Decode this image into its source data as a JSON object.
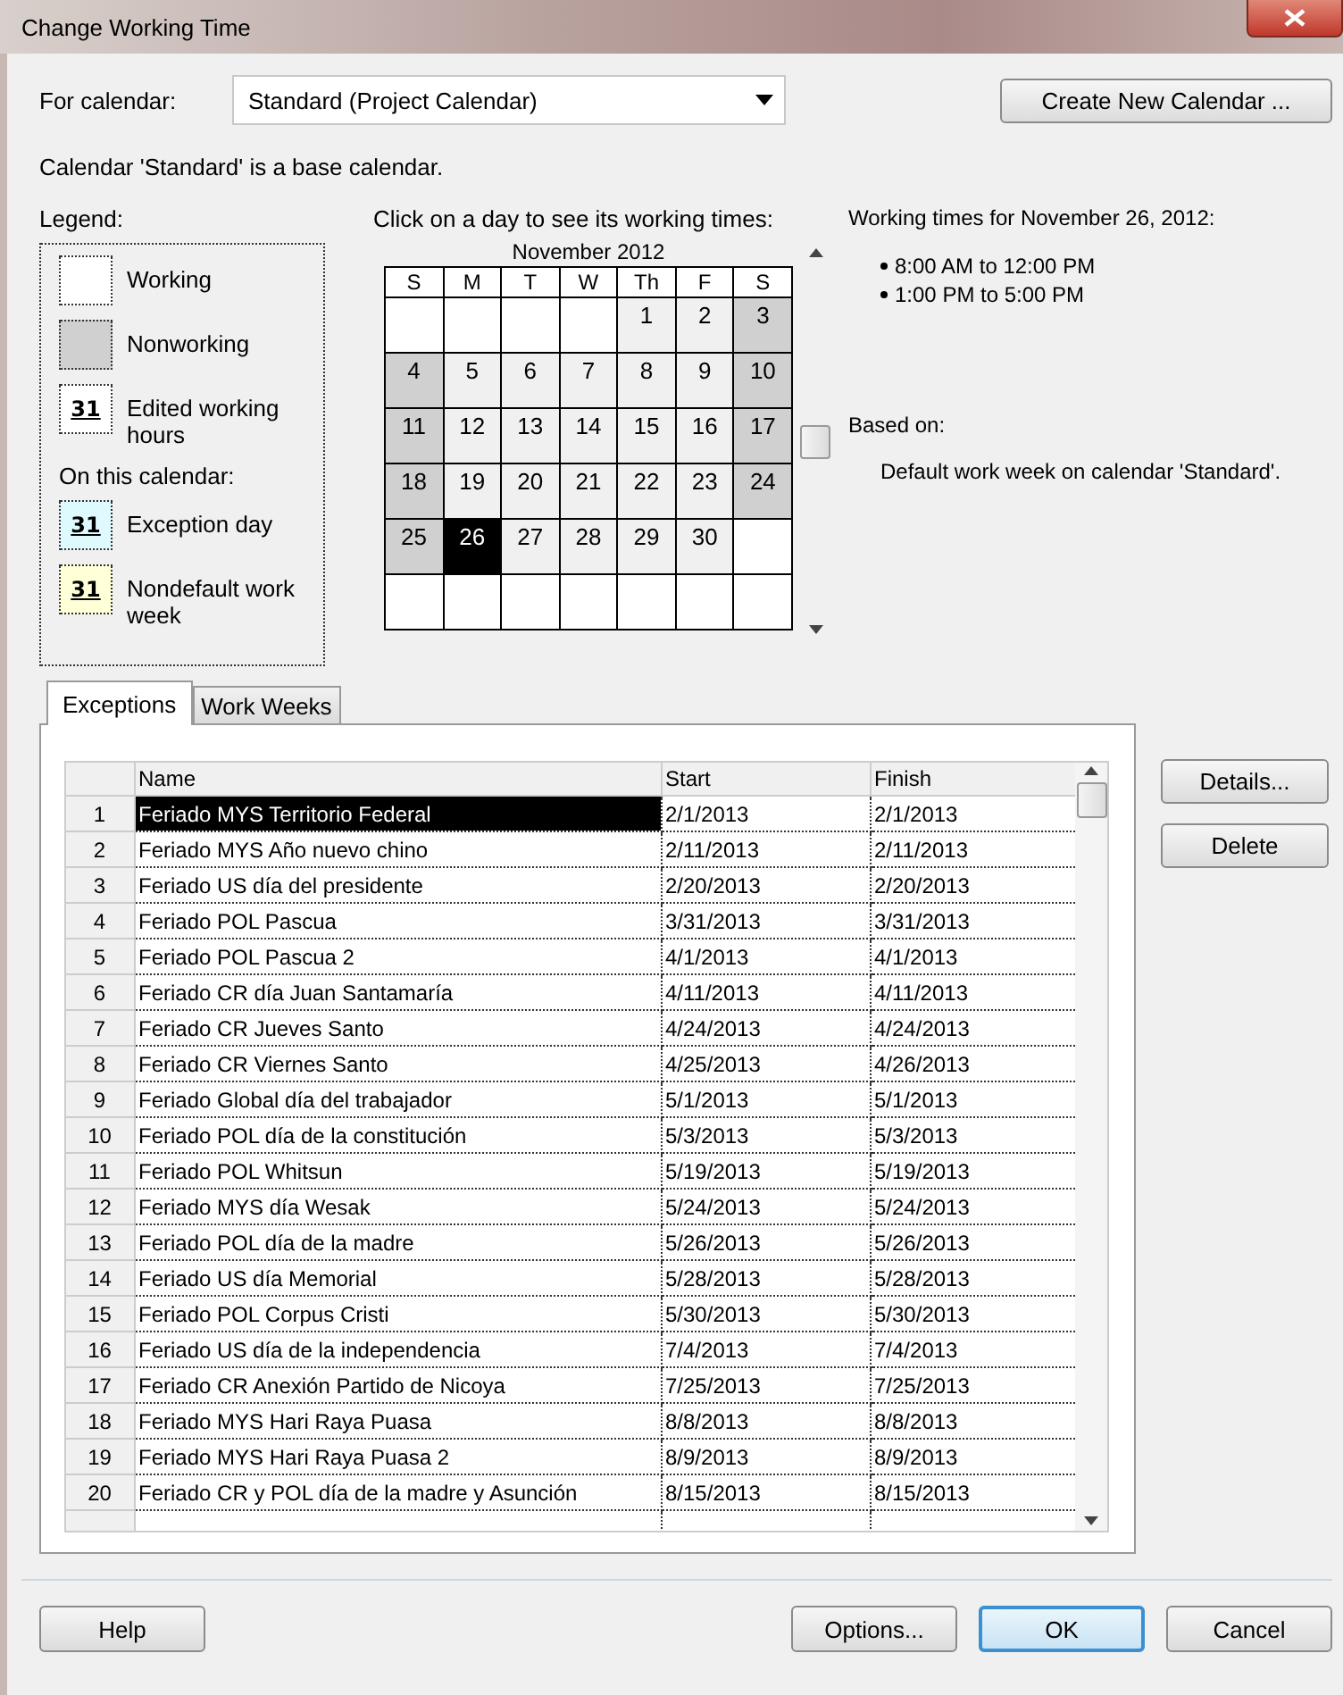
{
  "window": {
    "title": "Change Working Time"
  },
  "for_calendar": {
    "label": "For calendar:",
    "value": "Standard (Project Calendar)"
  },
  "create_button": "Create New Calendar ...",
  "calendar_note": "Calendar 'Standard' is a base calendar.",
  "legend": {
    "title": "Legend:",
    "items": [
      {
        "kind": "working",
        "label": "Working"
      },
      {
        "kind": "nonworking",
        "label": "Nonworking"
      },
      {
        "kind": "edited",
        "mark": "31",
        "label": "Edited working hours"
      }
    ],
    "subtitle": "On this calendar:",
    "calendar_items": [
      {
        "kind": "exception",
        "mark": "31",
        "label": "Exception day"
      },
      {
        "kind": "nondefault",
        "mark": "31",
        "label": "Nondefault work week"
      }
    ]
  },
  "calendar": {
    "instruction": "Click on a day to see its working times:",
    "month": "November 2012",
    "weekdays": [
      "S",
      "M",
      "T",
      "W",
      "Th",
      "F",
      "S"
    ],
    "weeks": [
      [
        {
          "kind": "empty"
        },
        {
          "kind": "empty"
        },
        {
          "kind": "empty"
        },
        {
          "kind": "empty"
        },
        {
          "kind": "day",
          "day": "1",
          "nonworking": false,
          "selected": false
        },
        {
          "kind": "day",
          "day": "2",
          "nonworking": false,
          "selected": false
        },
        {
          "kind": "day",
          "day": "3",
          "nonworking": true,
          "selected": false
        }
      ],
      [
        {
          "kind": "day",
          "day": "4",
          "nonworking": true,
          "selected": false
        },
        {
          "kind": "day",
          "day": "5",
          "nonworking": false,
          "selected": false
        },
        {
          "kind": "day",
          "day": "6",
          "nonworking": false,
          "selected": false
        },
        {
          "kind": "day",
          "day": "7",
          "nonworking": false,
          "selected": false
        },
        {
          "kind": "day",
          "day": "8",
          "nonworking": false,
          "selected": false
        },
        {
          "kind": "day",
          "day": "9",
          "nonworking": false,
          "selected": false
        },
        {
          "kind": "day",
          "day": "10",
          "nonworking": true,
          "selected": false
        }
      ],
      [
        {
          "kind": "day",
          "day": "11",
          "nonworking": true,
          "selected": false
        },
        {
          "kind": "day",
          "day": "12",
          "nonworking": false,
          "selected": false
        },
        {
          "kind": "day",
          "day": "13",
          "nonworking": false,
          "selected": false
        },
        {
          "kind": "day",
          "day": "14",
          "nonworking": false,
          "selected": false
        },
        {
          "kind": "day",
          "day": "15",
          "nonworking": false,
          "selected": false
        },
        {
          "kind": "day",
          "day": "16",
          "nonworking": false,
          "selected": false
        },
        {
          "kind": "day",
          "day": "17",
          "nonworking": true,
          "selected": false
        }
      ],
      [
        {
          "kind": "day",
          "day": "18",
          "nonworking": true,
          "selected": false
        },
        {
          "kind": "day",
          "day": "19",
          "nonworking": false,
          "selected": false
        },
        {
          "kind": "day",
          "day": "20",
          "nonworking": false,
          "selected": false
        },
        {
          "kind": "day",
          "day": "21",
          "nonworking": false,
          "selected": false
        },
        {
          "kind": "day",
          "day": "22",
          "nonworking": false,
          "selected": false
        },
        {
          "kind": "day",
          "day": "23",
          "nonworking": false,
          "selected": false
        },
        {
          "kind": "day",
          "day": "24",
          "nonworking": true,
          "selected": false
        }
      ],
      [
        {
          "kind": "day",
          "day": "25",
          "nonworking": true,
          "selected": false
        },
        {
          "kind": "day",
          "day": "26",
          "selected": true
        },
        {
          "kind": "day",
          "day": "27",
          "nonworking": false,
          "selected": false
        },
        {
          "kind": "day",
          "day": "28",
          "nonworking": false,
          "selected": false
        },
        {
          "kind": "day",
          "day": "29",
          "nonworking": false,
          "selected": false
        },
        {
          "kind": "day",
          "day": "30",
          "nonworking": false,
          "selected": false
        },
        {
          "kind": "empty"
        }
      ],
      [
        {
          "kind": "empty"
        },
        {
          "kind": "empty"
        },
        {
          "kind": "empty"
        },
        {
          "kind": "empty"
        },
        {
          "kind": "empty"
        },
        {
          "kind": "empty"
        },
        {
          "kind": "empty"
        }
      ]
    ]
  },
  "working_times": {
    "title": "Working times for November 26, 2012:",
    "times": [
      "8:00 AM to 12:00 PM",
      "1:00 PM to 5:00 PM"
    ],
    "based_on_label": "Based on:",
    "based_on": "Default work week on calendar 'Standard'."
  },
  "tabs": [
    {
      "label": "Exceptions",
      "selected": true
    },
    {
      "label": "Work Weeks",
      "selected": false
    }
  ],
  "table": {
    "columns": [
      "Name",
      "Start",
      "Finish"
    ],
    "rows": [
      {
        "num": "1",
        "name": "Feriado MYS Territorio Federal",
        "start": "2/1/2013",
        "finish": "2/1/2013",
        "selected": true
      },
      {
        "num": "2",
        "name": "Feriado MYS Año nuevo chino",
        "start": "2/11/2013",
        "finish": "2/11/2013",
        "selected": false
      },
      {
        "num": "3",
        "name": "Feriado US día del presidente",
        "start": "2/20/2013",
        "finish": "2/20/2013",
        "selected": false
      },
      {
        "num": "4",
        "name": "Feriado POL Pascua",
        "start": "3/31/2013",
        "finish": "3/31/2013",
        "selected": false
      },
      {
        "num": "5",
        "name": "Feriado POL Pascua 2",
        "start": "4/1/2013",
        "finish": "4/1/2013",
        "selected": false
      },
      {
        "num": "6",
        "name": "Feriado CR día Juan Santamaría",
        "start": "4/11/2013",
        "finish": "4/11/2013",
        "selected": false
      },
      {
        "num": "7",
        "name": "Feriado CR Jueves Santo",
        "start": "4/24/2013",
        "finish": "4/24/2013",
        "selected": false
      },
      {
        "num": "8",
        "name": "Feriado CR Viernes Santo",
        "start": "4/25/2013",
        "finish": "4/26/2013",
        "selected": false
      },
      {
        "num": "9",
        "name": "Feriado Global día del trabajador",
        "start": "5/1/2013",
        "finish": "5/1/2013",
        "selected": false
      },
      {
        "num": "10",
        "name": "Feriado POL día de la constitución",
        "start": "5/3/2013",
        "finish": "5/3/2013",
        "selected": false
      },
      {
        "num": "11",
        "name": "Feriado POL Whitsun",
        "start": "5/19/2013",
        "finish": "5/19/2013",
        "selected": false
      },
      {
        "num": "12",
        "name": "Feriado MYS día Wesak",
        "start": "5/24/2013",
        "finish": "5/24/2013",
        "selected": false
      },
      {
        "num": "13",
        "name": "Feriado POL día de la madre",
        "start": "5/26/2013",
        "finish": "5/26/2013",
        "selected": false
      },
      {
        "num": "14",
        "name": "Feriado US día Memorial",
        "start": "5/28/2013",
        "finish": "5/28/2013",
        "selected": false
      },
      {
        "num": "15",
        "name": "Feriado POL Corpus Cristi",
        "start": "5/30/2013",
        "finish": "5/30/2013",
        "selected": false
      },
      {
        "num": "16",
        "name": "Feriado US día de  la independencia",
        "start": "7/4/2013",
        "finish": "7/4/2013",
        "selected": false
      },
      {
        "num": "17",
        "name": "Feriado CR Anexión  Partido de Nicoya",
        "start": "7/25/2013",
        "finish": "7/25/2013",
        "selected": false
      },
      {
        "num": "18",
        "name": "Feriado MYS Hari Raya Puasa",
        "start": "8/8/2013",
        "finish": "8/8/2013",
        "selected": false
      },
      {
        "num": "19",
        "name": "Feriado MYS Hari Raya Puasa 2",
        "start": "8/9/2013",
        "finish": "8/9/2013",
        "selected": false
      },
      {
        "num": "20",
        "name": "Feriado CR y POL día de la madre y Asunción",
        "start": "8/15/2013",
        "finish": "8/15/2013",
        "selected": false
      }
    ]
  },
  "side_buttons": [
    "Details...",
    "Delete"
  ],
  "footer": {
    "help": "Help",
    "buttons": [
      {
        "label": "Options...",
        "default": false
      },
      {
        "label": "OK",
        "default": true
      },
      {
        "label": "Cancel",
        "default": false
      }
    ]
  }
}
